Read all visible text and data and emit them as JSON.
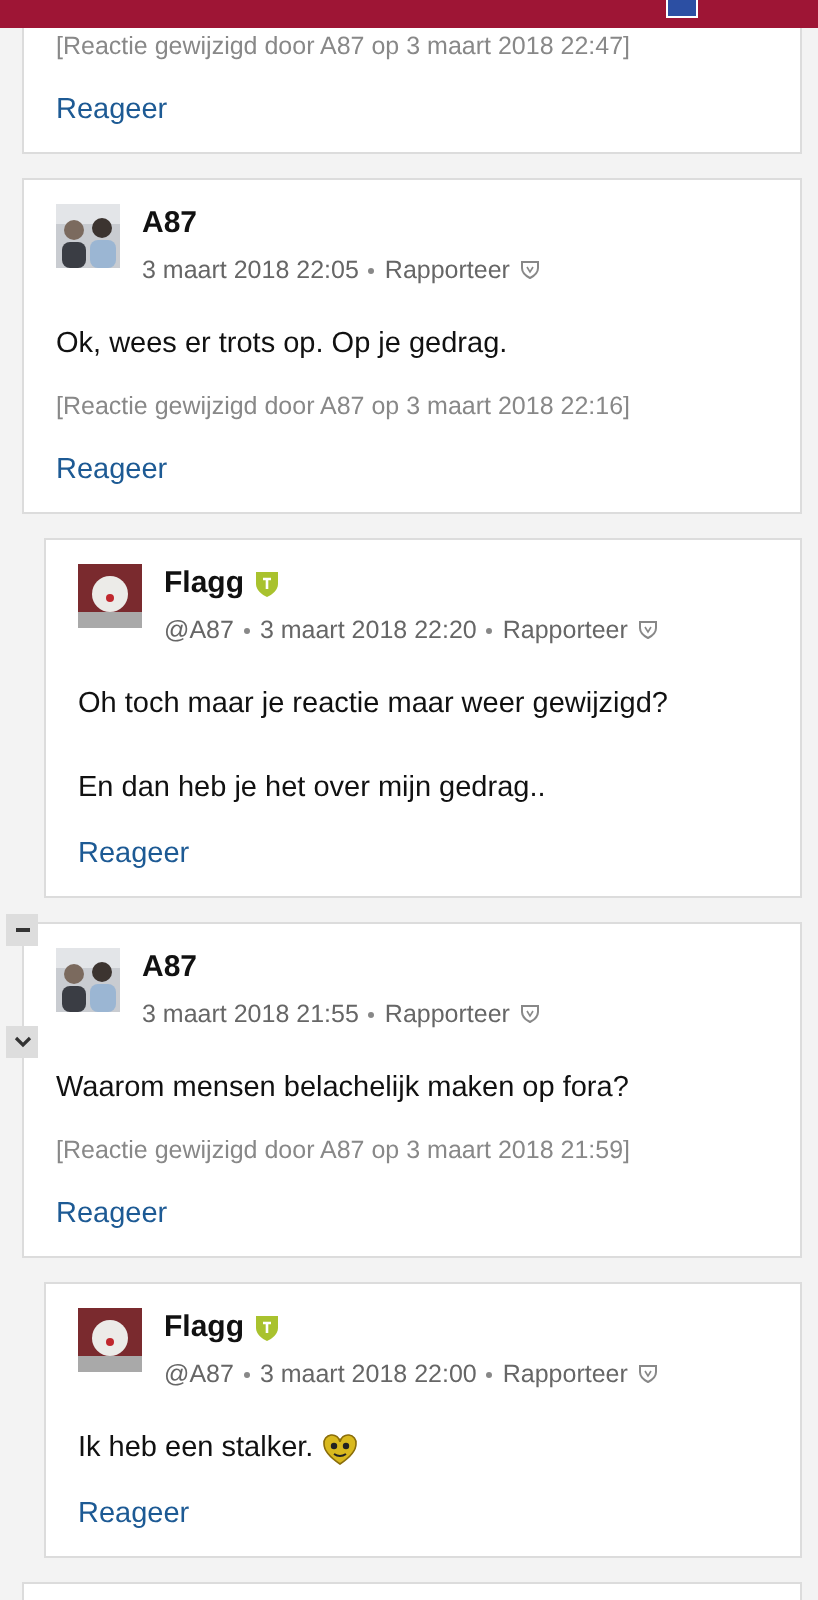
{
  "comments": [
    {
      "cut_top": true,
      "nested": false,
      "edited": "[Reactie gewijzigd door A87 op 3 maart 2018 22:47]",
      "reply": "Reageer"
    },
    {
      "nested": false,
      "author": "A87",
      "avatar": {
        "kind": "duo"
      },
      "date": "3 maart 2018 22:05",
      "report": "Rapporteer",
      "body": [
        "Ok, wees er trots op. Op je gedrag."
      ],
      "edited": "[Reactie gewijzigd door A87 op 3 maart 2018 22:16]",
      "reply": "Reageer"
    },
    {
      "nested": true,
      "author": "Flagg",
      "moderator": true,
      "avatar": {
        "kind": "clown"
      },
      "mention": "@A87",
      "date": "3 maart 2018 22:20",
      "report": "Rapporteer",
      "body": [
        "Oh toch maar je reactie maar weer gewijzigd?",
        "En dan heb je het over mijn gedrag.."
      ],
      "reply": "Reageer"
    },
    {
      "nested": false,
      "collapsible": true,
      "author": "A87",
      "avatar": {
        "kind": "duo"
      },
      "date": "3 maart 2018 21:55",
      "report": "Rapporteer",
      "body": [
        "Waarom mensen belachelijk maken op fora?"
      ],
      "edited": "[Reactie gewijzigd door A87 op 3 maart 2018 21:59]",
      "reply": "Reageer"
    },
    {
      "nested": true,
      "author": "Flagg",
      "moderator": true,
      "avatar": {
        "kind": "clown"
      },
      "mention": "@A87",
      "date": "3 maart 2018 22:00",
      "report": "Rapporteer",
      "body": [
        "Ik heb een stalker."
      ],
      "emoji": true,
      "reply": "Reageer"
    },
    {
      "cut_bottom": true,
      "nested": false
    }
  ]
}
